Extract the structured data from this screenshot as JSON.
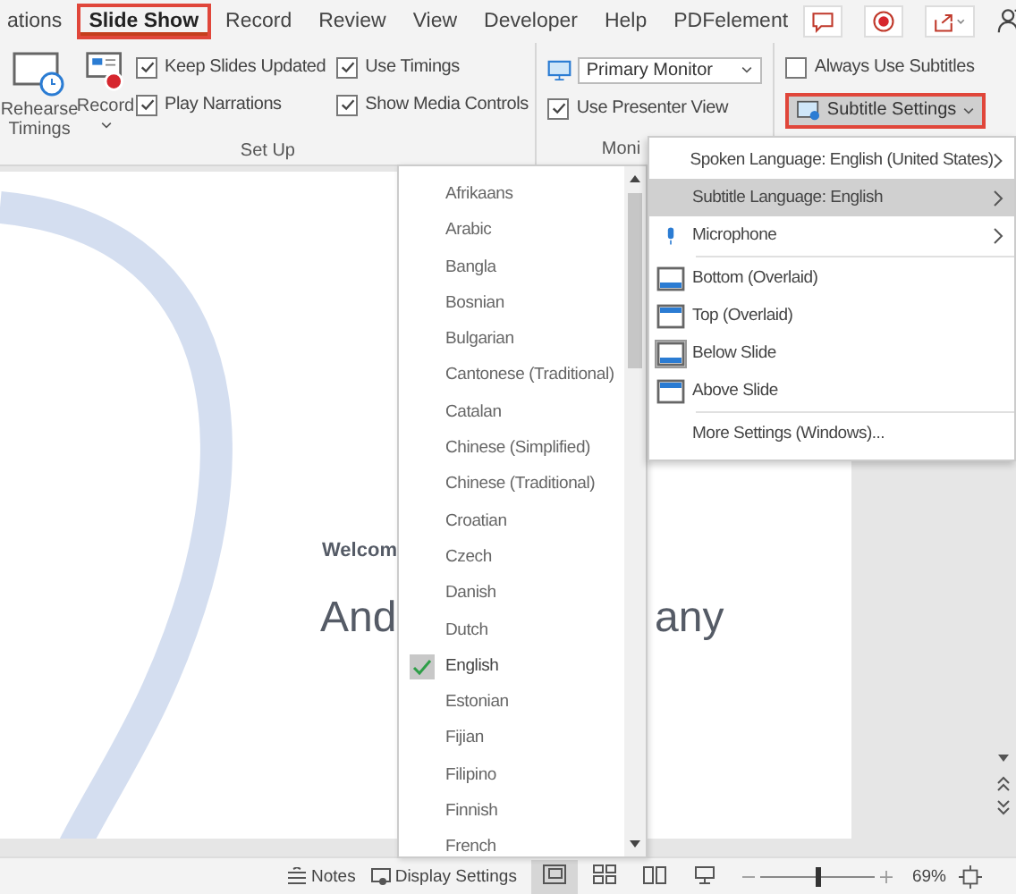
{
  "ribbon_tabs": [
    {
      "label": "ations",
      "selected": false
    },
    {
      "label": "Slide Show",
      "selected": true
    },
    {
      "label": "Record",
      "selected": false
    },
    {
      "label": "Review",
      "selected": false
    },
    {
      "label": "View",
      "selected": false
    },
    {
      "label": "Developer",
      "selected": false
    },
    {
      "label": "Help",
      "selected": false
    },
    {
      "label": "PDFelement",
      "selected": false
    }
  ],
  "setup_group": {
    "label": "Set Up",
    "rehearse_button": "Rehearse Timings",
    "record_button": "Record",
    "checkboxes": [
      {
        "label": "Keep Slides Updated",
        "checked": true
      },
      {
        "label": "Play Narrations",
        "checked": true
      },
      {
        "label": "Use Timings",
        "checked": true
      },
      {
        "label": "Show Media Controls",
        "checked": true
      }
    ]
  },
  "monitors_group": {
    "label": "Moni",
    "monitor": "Primary Monitor",
    "checkboxes": [
      {
        "label": "Use Presenter View",
        "checked": true
      }
    ]
  },
  "captions_group": {
    "checkboxes": [
      {
        "label": "Always Use Subtitles",
        "checked": false
      }
    ],
    "settings_button": {
      "label": "Subtitle Settings",
      "selected": true
    }
  },
  "slide": {
    "subtitle": "Welcom",
    "title_left": "And",
    "title_right": "any"
  },
  "languages": [
    {
      "label": "Afrikaans",
      "selected": false
    },
    {
      "label": "Arabic",
      "selected": false
    },
    {
      "label": "Bangla",
      "selected": false
    },
    {
      "label": "Bosnian",
      "selected": false
    },
    {
      "label": "Bulgarian",
      "selected": false
    },
    {
      "label": "Cantonese (Traditional)",
      "selected": false
    },
    {
      "label": "Catalan",
      "selected": false
    },
    {
      "label": "Chinese (Simplified)",
      "selected": false
    },
    {
      "label": "Chinese (Traditional)",
      "selected": false
    },
    {
      "label": "Croatian",
      "selected": false
    },
    {
      "label": "Czech",
      "selected": false
    },
    {
      "label": "Danish",
      "selected": false
    },
    {
      "label": "Dutch",
      "selected": false
    },
    {
      "label": "English",
      "selected": true
    },
    {
      "label": "Estonian",
      "selected": false
    },
    {
      "label": "Fijian",
      "selected": false
    },
    {
      "label": "Filipino",
      "selected": false
    },
    {
      "label": "Finnish",
      "selected": false
    },
    {
      "label": "French",
      "selected": false
    }
  ],
  "subtitle_menu": [
    {
      "kind": "submenu",
      "label": "Spoken Language: English (United States)",
      "selected": false
    },
    {
      "kind": "submenu",
      "label": "Subtitle Language: English",
      "selected": true
    },
    {
      "kind": "microphone",
      "label": "Microphone",
      "selected": false
    },
    {
      "kind": "bottom",
      "label": "Bottom (Overlaid)",
      "selected": false
    },
    {
      "kind": "top",
      "label": "Top (Overlaid)",
      "selected": false
    },
    {
      "kind": "below",
      "label": "Below Slide",
      "selected": true
    },
    {
      "kind": "above",
      "label": "Above Slide",
      "selected": false
    },
    {
      "kind": "command",
      "label": "More Settings (Windows)...",
      "selected": false
    }
  ],
  "status_bar": {
    "notes": "Notes",
    "display_settings": "Display Settings",
    "views": [
      {
        "kind": "normal",
        "selected": true
      },
      {
        "kind": "sorter",
        "selected": false
      },
      {
        "kind": "reading",
        "selected": false
      },
      {
        "kind": "slideshow",
        "selected": false
      }
    ],
    "zoom": {
      "level": 0.5,
      "reading": "69%"
    }
  }
}
